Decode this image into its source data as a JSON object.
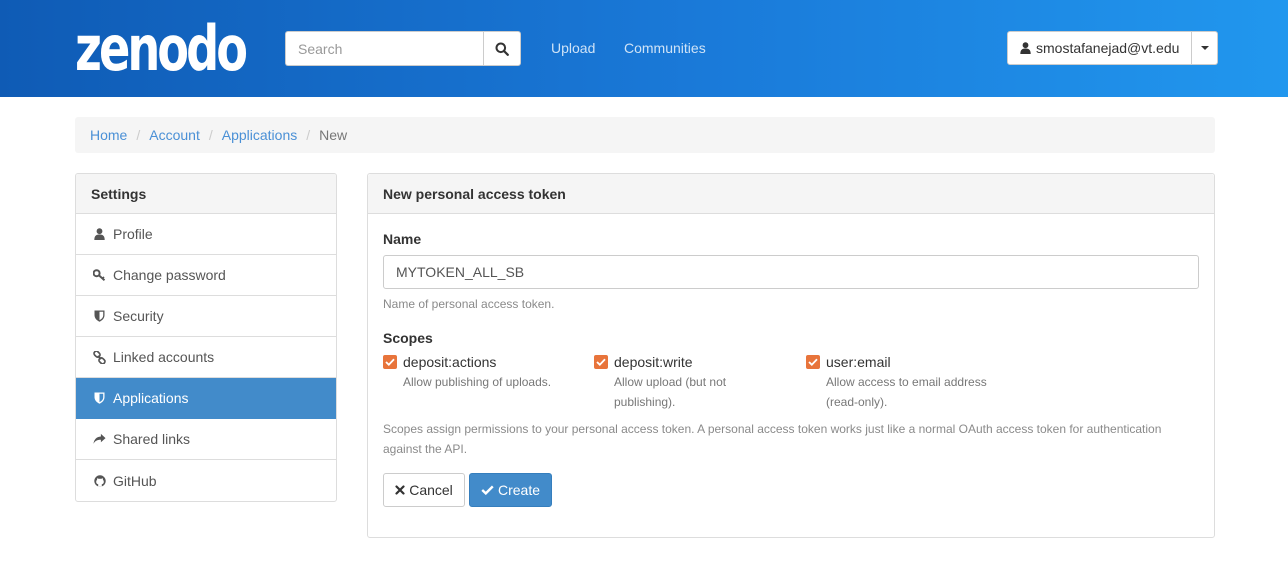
{
  "header": {
    "logo_text": "zenodo",
    "search": {
      "placeholder": "Search",
      "value": ""
    },
    "nav": [
      {
        "label": "Upload"
      },
      {
        "label": "Communities"
      }
    ],
    "user": {
      "email": "smostafanejad@vt.edu"
    }
  },
  "breadcrumb": [
    {
      "label": "Home"
    },
    {
      "label": "Account"
    },
    {
      "label": "Applications"
    },
    {
      "label": "New"
    }
  ],
  "sidebar": {
    "heading": "Settings",
    "items": [
      {
        "label": "Profile",
        "icon": "user-icon"
      },
      {
        "label": "Change password",
        "icon": "key-icon"
      },
      {
        "label": "Security",
        "icon": "shield-icon"
      },
      {
        "label": "Linked accounts",
        "icon": "link-icon"
      },
      {
        "label": "Applications",
        "icon": "shield-icon",
        "active": true
      },
      {
        "label": "Shared links",
        "icon": "share-icon"
      },
      {
        "label": "GitHub",
        "icon": "github-icon"
      }
    ]
  },
  "form": {
    "title": "New personal access token",
    "name_label": "Name",
    "name_value": "MYTOKEN_ALL_SB",
    "name_help": "Name of personal access token.",
    "scopes_label": "Scopes",
    "scopes": [
      {
        "name": "deposit:actions",
        "description": "Allow publishing of uploads.",
        "checked": true
      },
      {
        "name": "deposit:write",
        "description": "Allow upload (but not publishing).",
        "checked": true
      },
      {
        "name": "user:email",
        "description": "Allow access to email address (read-only).",
        "checked": true
      }
    ],
    "scopes_help": "Scopes assign permissions to your personal access token. A personal access token works just like a normal OAuth access token for authentication against the API.",
    "cancel_label": "Cancel",
    "create_label": "Create"
  },
  "colors": {
    "header_start": "#0f5bb5",
    "header_end": "#2197ee",
    "primary": "#428bca",
    "checkbox": "#e8743b",
    "link": "#4a90d6"
  }
}
